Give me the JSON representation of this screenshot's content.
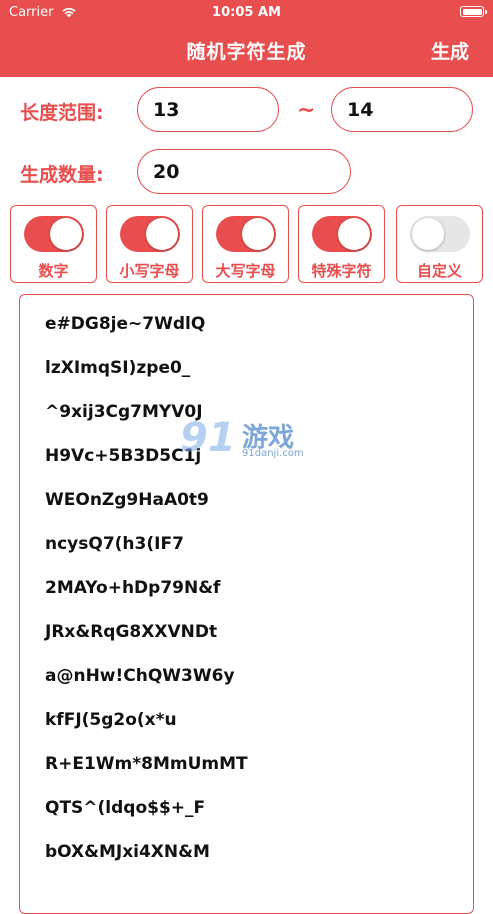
{
  "status": {
    "carrier": "Carrier",
    "time": "10:05 AM"
  },
  "nav": {
    "title": "随机字符生成",
    "action": "生成"
  },
  "form": {
    "length_label": "长度范围:",
    "min": "13",
    "separator": "~",
    "max": "14",
    "count_label": "生成数量:",
    "count": "20"
  },
  "toggles": [
    {
      "label": "数字",
      "on": true
    },
    {
      "label": "小写字母",
      "on": true
    },
    {
      "label": "大写字母",
      "on": true
    },
    {
      "label": "特殊字符",
      "on": true
    },
    {
      "label": "自定义",
      "on": false
    }
  ],
  "results": [
    "e#DG8je~7WdlQ",
    "lzXImqSI)zpe0_",
    "^9xij3Cg7MYV0J",
    "H9Vc+5B3D5C1j",
    "WEOnZg9HaA0t9",
    "ncysQ7(h3(IF7",
    "2MAYo+hDp79N&f",
    "JRx&RqG8XXVNDt",
    "a@nHw!ChQW3W6y",
    "kfFJ(5g2o(x*u",
    "R+E1Wm*8MmUmMT",
    "QTS^(ldqo$$+_F",
    "bOX&MJxi4XN&M"
  ],
  "watermark": {
    "logo": "91",
    "text": "游戏",
    "url": "91danji.com"
  },
  "colors": {
    "accent": "#e94e4e",
    "switch_off": "#e6e6e6",
    "text": "#111111"
  },
  "icons": {
    "wifi": "wifi-icon",
    "battery": "battery-icon"
  }
}
